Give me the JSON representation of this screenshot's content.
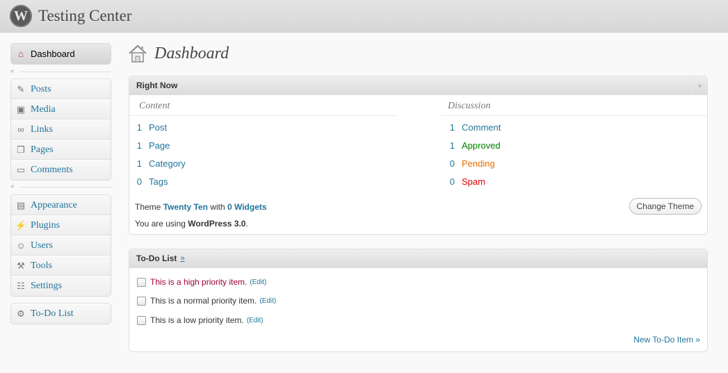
{
  "header": {
    "site_title": "Testing Center",
    "logo_letter": "W"
  },
  "sidebar": {
    "dashboard": "Dashboard",
    "group1": [
      "Posts",
      "Media",
      "Links",
      "Pages",
      "Comments"
    ],
    "group2": [
      "Appearance",
      "Plugins",
      "Users",
      "Tools",
      "Settings"
    ],
    "group3": [
      "To-Do List"
    ],
    "collapse_arrow": "«"
  },
  "page": {
    "title": "Dashboard"
  },
  "right_now": {
    "title": "Right Now",
    "content_heading": "Content",
    "discussion_heading": "Discussion",
    "content": [
      {
        "num": "1",
        "label": "Post"
      },
      {
        "num": "1",
        "label": "Page"
      },
      {
        "num": "1",
        "label": "Category"
      },
      {
        "num": "0",
        "label": "Tags"
      }
    ],
    "discussion": [
      {
        "num": "1",
        "label": "Comment"
      },
      {
        "num": "1",
        "label": "Approved"
      },
      {
        "num": "0",
        "label": "Pending"
      },
      {
        "num": "0",
        "label": "Spam"
      }
    ],
    "theme_prefix": "Theme",
    "theme_name": "Twenty Ten",
    "theme_with": "with",
    "widgets": "0 Widgets",
    "using_prefix": "You are using",
    "wp_version": "WordPress 3.0",
    "change_theme": "Change Theme"
  },
  "todo": {
    "title": "To-Do List",
    "more": "»",
    "items": [
      {
        "text": "This is a high priority item.",
        "edit": "(Edit)"
      },
      {
        "text": "This is a normal priority item.",
        "edit": "(Edit)"
      },
      {
        "text": "This is a low priority item.",
        "edit": "(Edit)"
      }
    ],
    "new_item": "New To-Do Item »"
  },
  "colors": {
    "link": "#21759b",
    "approved": "#008000",
    "pending": "#e66f00",
    "spam": "#dd0000",
    "high_priority": "#a1003a"
  }
}
